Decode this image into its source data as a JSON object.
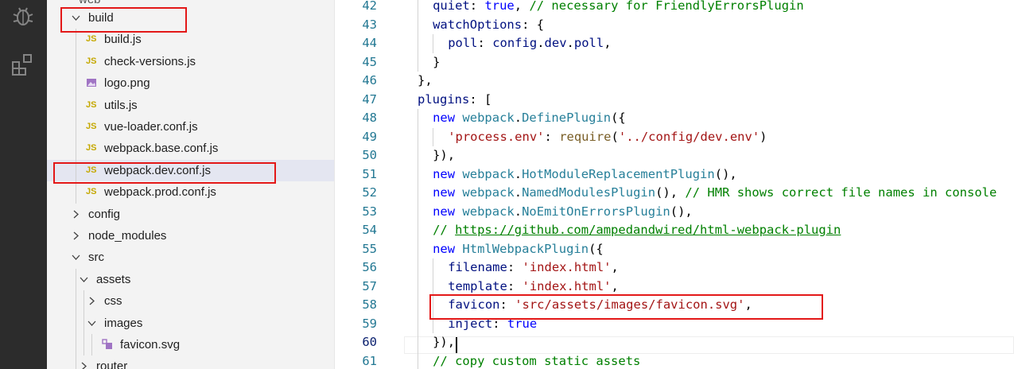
{
  "activity_bar": {
    "icons": [
      "debug-icon",
      "extensions-icon"
    ]
  },
  "explorer": {
    "top_partial_label": "web",
    "rows": [
      {
        "label": "build",
        "kind": "folder-open"
      },
      {
        "label": "build.js",
        "kind": "js"
      },
      {
        "label": "check-versions.js",
        "kind": "js"
      },
      {
        "label": "logo.png",
        "kind": "image"
      },
      {
        "label": "utils.js",
        "kind": "js"
      },
      {
        "label": "vue-loader.conf.js",
        "kind": "js"
      },
      {
        "label": "webpack.base.conf.js",
        "kind": "js"
      },
      {
        "label": "webpack.dev.conf.js",
        "kind": "js",
        "selected": true
      },
      {
        "label": "webpack.prod.conf.js",
        "kind": "js"
      },
      {
        "label": "config",
        "kind": "folder-closed"
      },
      {
        "label": "node_modules",
        "kind": "folder-closed"
      },
      {
        "label": "src",
        "kind": "folder-open"
      },
      {
        "label": "assets",
        "kind": "folder-open"
      },
      {
        "label": "css",
        "kind": "folder-closed"
      },
      {
        "label": "images",
        "kind": "folder-open"
      },
      {
        "label": "favicon.svg",
        "kind": "svg"
      },
      {
        "label": "router",
        "kind": "folder-closed"
      }
    ],
    "js_badge": "JS"
  },
  "editor": {
    "active_line": 60,
    "lines": [
      {
        "n": "42",
        "tokens": [
          [
            "quiet",
            "prop"
          ],
          [
            ": ",
            "p"
          ],
          [
            "true",
            "kw"
          ],
          [
            ", ",
            "p"
          ],
          [
            "// necessary for FriendlyErrorsPlugin",
            "cmt"
          ]
        ]
      },
      {
        "n": "43",
        "tokens": [
          [
            "watchOptions",
            "prop"
          ],
          [
            ": {",
            "p"
          ]
        ]
      },
      {
        "n": "44",
        "tokens": [
          [
            "poll",
            "prop"
          ],
          [
            ": ",
            "p"
          ],
          [
            "config",
            "prop"
          ],
          [
            ".",
            "p"
          ],
          [
            "dev",
            "prop"
          ],
          [
            ".",
            "p"
          ],
          [
            "poll",
            "prop"
          ],
          [
            ",",
            "p"
          ]
        ]
      },
      {
        "n": "45",
        "tokens": [
          [
            "}",
            "p"
          ]
        ]
      },
      {
        "n": "46",
        "tokens": [
          [
            "},",
            "p"
          ]
        ]
      },
      {
        "n": "47",
        "tokens": [
          [
            "plugins",
            "prop"
          ],
          [
            ": [",
            "p"
          ]
        ]
      },
      {
        "n": "48",
        "tokens": [
          [
            "new ",
            "kw"
          ],
          [
            "webpack",
            "type"
          ],
          [
            ".",
            "p"
          ],
          [
            "DefinePlugin",
            "type"
          ],
          [
            "({",
            "p"
          ]
        ]
      },
      {
        "n": "49",
        "tokens": [
          [
            "'process.env'",
            "str"
          ],
          [
            ": ",
            "p"
          ],
          [
            "require",
            "fn"
          ],
          [
            "(",
            "p"
          ],
          [
            "'../config/dev.env'",
            "str"
          ],
          [
            ")",
            "p"
          ]
        ]
      },
      {
        "n": "50",
        "tokens": [
          [
            "}),",
            "p"
          ]
        ]
      },
      {
        "n": "51",
        "tokens": [
          [
            "new ",
            "kw"
          ],
          [
            "webpack",
            "type"
          ],
          [
            ".",
            "p"
          ],
          [
            "HotModuleReplacementPlugin",
            "type"
          ],
          [
            "(),",
            "p"
          ]
        ]
      },
      {
        "n": "52",
        "tokens": [
          [
            "new ",
            "kw"
          ],
          [
            "webpack",
            "type"
          ],
          [
            ".",
            "p"
          ],
          [
            "NamedModulesPlugin",
            "type"
          ],
          [
            "(), ",
            "p"
          ],
          [
            "// HMR shows correct file names in console",
            "cmt"
          ]
        ]
      },
      {
        "n": "53",
        "tokens": [
          [
            "new ",
            "kw"
          ],
          [
            "webpack",
            "type"
          ],
          [
            ".",
            "p"
          ],
          [
            "NoEmitOnErrorsPlugin",
            "type"
          ],
          [
            "(),",
            "p"
          ]
        ]
      },
      {
        "n": "54",
        "tokens": [
          [
            "// ",
            "cmt"
          ],
          [
            "https://github.com/ampedandwired/html-webpack-plugin",
            "link"
          ]
        ]
      },
      {
        "n": "55",
        "tokens": [
          [
            "new ",
            "kw"
          ],
          [
            "HtmlWebpackPlugin",
            "type"
          ],
          [
            "({",
            "p"
          ]
        ]
      },
      {
        "n": "56",
        "tokens": [
          [
            "filename",
            "prop"
          ],
          [
            ": ",
            "p"
          ],
          [
            "'index.html'",
            "str"
          ],
          [
            ",",
            "p"
          ]
        ]
      },
      {
        "n": "57",
        "tokens": [
          [
            "template",
            "prop"
          ],
          [
            ": ",
            "p"
          ],
          [
            "'index.html'",
            "str"
          ],
          [
            ",",
            "p"
          ]
        ]
      },
      {
        "n": "58",
        "tokens": [
          [
            "favicon",
            "prop"
          ],
          [
            ": ",
            "p"
          ],
          [
            "'src/assets/images/favicon.svg'",
            "str"
          ],
          [
            ",",
            "p"
          ]
        ]
      },
      {
        "n": "59",
        "tokens": [
          [
            "inject",
            "prop"
          ],
          [
            ": ",
            "p"
          ],
          [
            "true",
            "kw"
          ]
        ]
      },
      {
        "n": "60",
        "tokens": [
          [
            "}),",
            "p"
          ]
        ]
      },
      {
        "n": "61",
        "tokens": [
          [
            "// copy custom static assets",
            "cmt"
          ]
        ]
      }
    ]
  },
  "colors": {
    "highlight_box": "#e31818",
    "activity_bar": "#2c2c2c",
    "sidebar": "#f3f3f3",
    "selected_row": "#e4e6f1"
  }
}
